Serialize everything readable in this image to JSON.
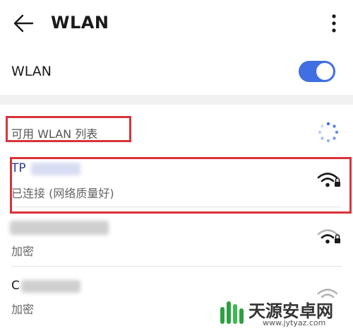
{
  "header": {
    "title": "WLAN"
  },
  "toggle": {
    "label": "WLAN",
    "on": true
  },
  "list": {
    "title": "可用 WLAN 列表"
  },
  "networks": [
    {
      "name": "TP",
      "status": "已连接 (网络质量好)",
      "secured": true
    },
    {
      "name": "",
      "status": "加密",
      "secured": true
    },
    {
      "name": "C",
      "status": "加密",
      "secured": true
    }
  ],
  "watermark": {
    "title": "天源安卓网",
    "url": "www.jytyaz.com"
  },
  "colors": {
    "accent": "#3f6fe0",
    "highlight": "#d9333a",
    "network_name": "#2c3f9a"
  }
}
